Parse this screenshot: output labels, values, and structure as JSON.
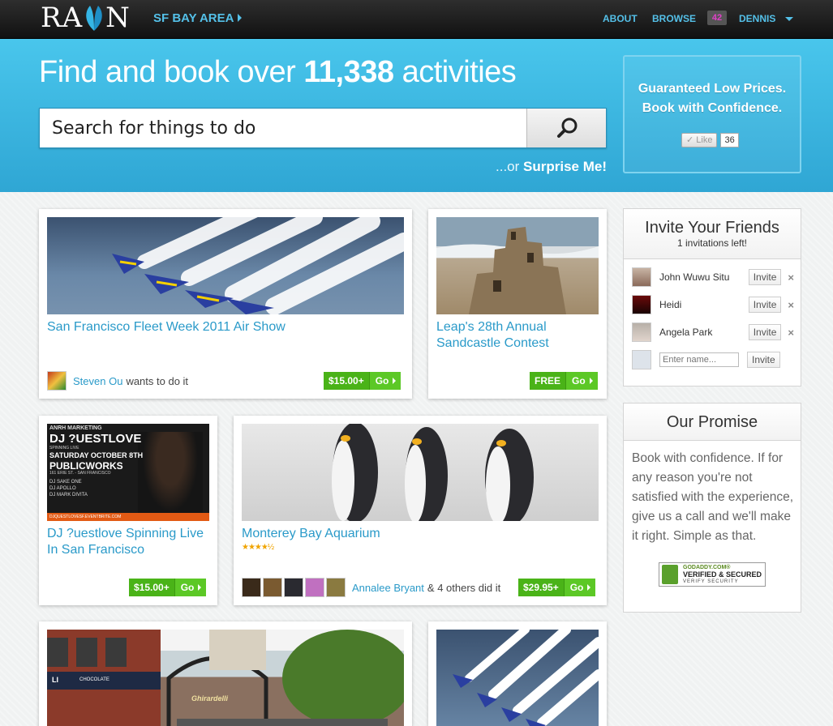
{
  "header": {
    "logo_text_left": "RA",
    "logo_text_right": "N",
    "region": "SF BAY AREA",
    "nav": {
      "about": "ABOUT",
      "browse": "BROWSE",
      "notifications_count": "42",
      "user": "DENNIS"
    }
  },
  "hero": {
    "headline_prefix": "Find and book over ",
    "activity_count": "11,338",
    "headline_suffix": " activities",
    "search_placeholder": "Search for things to do",
    "surprise_prefix": "...or ",
    "surprise_link": "Surprise Me!",
    "promo_line1": "Guaranteed Low Prices.",
    "promo_line2": "Book with Confidence.",
    "like_label": "Like",
    "like_count": "36"
  },
  "activities": [
    {
      "title": "San Francisco Fleet Week 2011 Air Show",
      "user": "Steven Ou",
      "action": "wants to do it",
      "price": "$15.00+",
      "go": "Go"
    },
    {
      "title": "Leap's 28th Annual Sandcastle Contest",
      "price": "FREE",
      "go": "Go"
    },
    {
      "title": "DJ ?uestlove Spinning Live In San Francisco",
      "price": "$15.00+",
      "go": "Go",
      "poster": {
        "top": "ANRH MARKETING",
        "name": "DJ ?UESTLOVE",
        "spin": "SPINNING LIVE",
        "date": "SATURDAY OCTOBER 8TH",
        "venue": "PUBLICWORKS",
        "addr": "161 ERIE ST. - SAN FRANCISCO",
        "djs": [
          "DJ SAKE ONE",
          "DJ APOLLO",
          "DJ MARK DIVITA"
        ],
        "url": "DJQUESTLOVESF.EVENTBRITE.COM"
      }
    },
    {
      "title": "Monterey Bay Aquarium",
      "rating": 4.5,
      "user": "Annalee Bryant",
      "action": "& 4 others did it",
      "price": "$29.95+",
      "go": "Go"
    },
    {
      "shop_sign": "CHOCOLATE",
      "shop_letters": "LI",
      "arch_sign": "Ghirardelli"
    },
    {}
  ],
  "invite": {
    "title": "Invite Your Friends",
    "subtitle": "1 invitations left!",
    "friends": [
      "John Wuwu Situ",
      "Heidi",
      "Angela Park"
    ],
    "invite_label": "Invite",
    "remove_label": "×",
    "name_placeholder": "Enter name..."
  },
  "promise": {
    "title": "Our Promise",
    "text": "Book with confidence. If for any reason you're not satisfied with the experience, give us a call and we'll make it right. Simple as that.",
    "badge_line1": "GODADDY.COM®",
    "badge_line2": "VERIFIED & SECURED",
    "badge_line3": "VERIFY SECURITY"
  },
  "colors": {
    "accent": "#2a9ac9",
    "hero": "#3fb7e2",
    "price_green": "#4ab318"
  }
}
